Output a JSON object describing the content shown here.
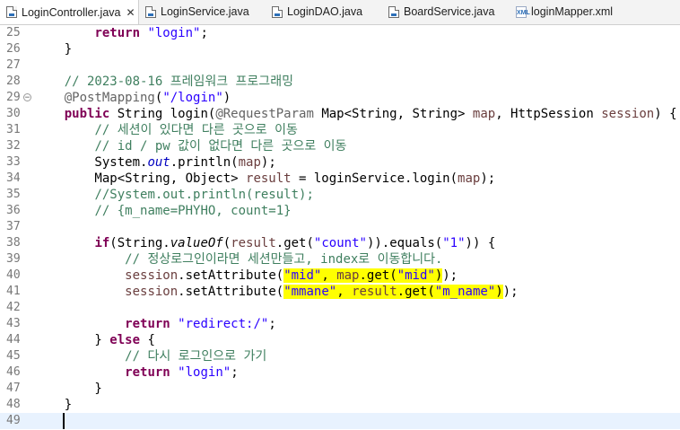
{
  "tabs": [
    {
      "label": "LoginController.java",
      "icon": "java-file-icon",
      "active": true,
      "close": "✕"
    },
    {
      "label": "LoginService.java",
      "icon": "java-file-icon",
      "active": false
    },
    {
      "label": "LoginDAO.java",
      "icon": "java-file-icon",
      "active": false
    },
    {
      "label": "BoardService.java",
      "icon": "java-file-icon",
      "active": false
    },
    {
      "label": "loginMapper.xml",
      "icon": "xml-file-icon",
      "active": false,
      "icon_text": "XML"
    }
  ],
  "colors": {
    "keyword": "#7f0055",
    "string": "#2a00ff",
    "comment": "#3f7f5f",
    "field": "#0000c0",
    "highlight": "#ffff00",
    "current_line": "#e8f2fe"
  },
  "lines": [
    {
      "n": "25",
      "t": "        return \"login\";"
    },
    {
      "n": "26",
      "t": "    }"
    },
    {
      "n": "27",
      "t": ""
    },
    {
      "n": "28",
      "t": "    // 2023-08-16 프레임워크 프로그래밍"
    },
    {
      "n": "29",
      "t": "    @PostMapping(\"/login\")"
    },
    {
      "n": "30",
      "t": "    public String login(@RequestParam Map<String, String> map, HttpSession session) {"
    },
    {
      "n": "31",
      "t": "        // 세션이 있다면 다른 곳으로 이동"
    },
    {
      "n": "32",
      "t": "        // id / pw 값이 없다면 다른 곳으로 이동"
    },
    {
      "n": "33",
      "t": "        System.out.println(map);"
    },
    {
      "n": "34",
      "t": "        Map<String, Object> result = loginService.login(map);"
    },
    {
      "n": "35",
      "t": "        //System.out.println(result);"
    },
    {
      "n": "36",
      "t": "        // {m_name=PHYHO, count=1}"
    },
    {
      "n": "37",
      "t": ""
    },
    {
      "n": "38",
      "t": "        if(String.valueOf(result.get(\"count\")).equals(\"1\")) {"
    },
    {
      "n": "39",
      "t": "            // 정상로그인이라면 세션만들고, index로 이동합니다."
    },
    {
      "n": "40",
      "t": "            session.setAttribute(\"mid\", map.get(\"mid\"));"
    },
    {
      "n": "41",
      "t": "            session.setAttribute(\"mmane\", result.get(\"m_name\"));"
    },
    {
      "n": "42",
      "t": ""
    },
    {
      "n": "43",
      "t": "            return \"redirect:/\";"
    },
    {
      "n": "44",
      "t": "        } else {"
    },
    {
      "n": "45",
      "t": "            // 다시 로그인으로 가기"
    },
    {
      "n": "46",
      "t": "            return \"login\";"
    },
    {
      "n": "47",
      "t": "        }"
    },
    {
      "n": "48",
      "t": "    }"
    },
    {
      "n": "49",
      "t": ""
    }
  ]
}
